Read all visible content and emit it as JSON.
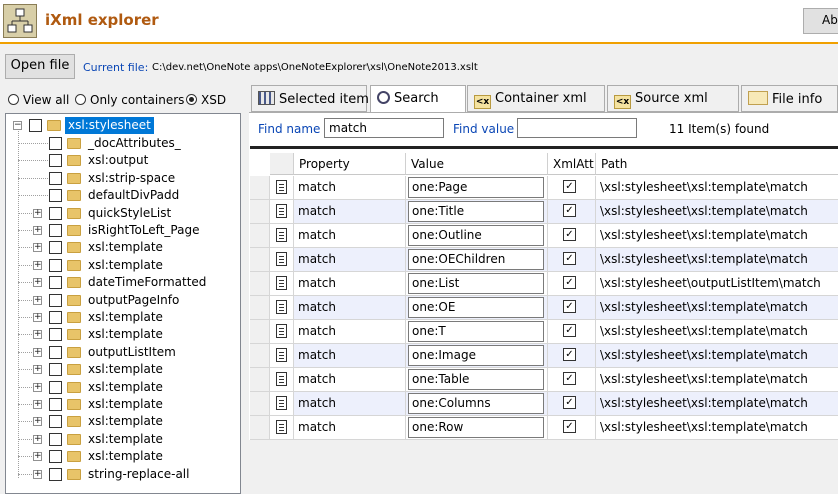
{
  "app": {
    "title": "iXml explorer",
    "about_label": "Ab"
  },
  "toolbar": {
    "open_file_label": "Open file",
    "current_file_label": "Current file:",
    "current_file_path": "C:\\dev.net\\OneNote apps\\OneNoteExplorer\\xsl\\OneNote2013.xslt"
  },
  "view_options": [
    {
      "label": "View all",
      "selected": false
    },
    {
      "label": "Only containers",
      "selected": false
    },
    {
      "label": "XSD",
      "selected": true
    }
  ],
  "tree": {
    "root": "xsl:stylesheet",
    "nodes": [
      {
        "label": "_docAttributes_",
        "expandable": false
      },
      {
        "label": "xsl:output",
        "expandable": false
      },
      {
        "label": "xsl:strip-space",
        "expandable": false
      },
      {
        "label": "defaultDivPadd",
        "expandable": false
      },
      {
        "label": "quickStyleList",
        "expandable": true
      },
      {
        "label": "isRightToLeft_Page",
        "expandable": true
      },
      {
        "label": "xsl:template",
        "expandable": true
      },
      {
        "label": "xsl:template",
        "expandable": true
      },
      {
        "label": "dateTimeFormatted",
        "expandable": true
      },
      {
        "label": "outputPageInfo",
        "expandable": true
      },
      {
        "label": "xsl:template",
        "expandable": true
      },
      {
        "label": "xsl:template",
        "expandable": true
      },
      {
        "label": "outputListItem",
        "expandable": true
      },
      {
        "label": "xsl:template",
        "expandable": true
      },
      {
        "label": "xsl:template",
        "expandable": true
      },
      {
        "label": "xsl:template",
        "expandable": true
      },
      {
        "label": "xsl:template",
        "expandable": true
      },
      {
        "label": "xsl:template",
        "expandable": true
      },
      {
        "label": "xsl:template",
        "expandable": true
      },
      {
        "label": "string-replace-all",
        "expandable": true
      }
    ]
  },
  "tabs": [
    {
      "label": "Selected item",
      "icon": "grid-icon",
      "active": false
    },
    {
      "label": "Search",
      "icon": "search-icon",
      "active": true
    },
    {
      "label": "Container xml",
      "icon": "xml-icon",
      "active": false
    },
    {
      "label": "Source xml",
      "icon": "xml-icon",
      "active": false
    },
    {
      "label": "File info",
      "icon": "file-info-icon",
      "active": false
    }
  ],
  "search": {
    "find_name_label": "Find name",
    "find_name_value": "match",
    "find_value_label": "Find value",
    "find_value_value": "",
    "items_found": "11  Item(s) found"
  },
  "grid": {
    "headers": [
      "Property",
      "Value",
      "XmlAtt",
      "Path"
    ],
    "rows": [
      {
        "property": "match",
        "value": "one:Page",
        "xmlatt": true,
        "path": "\\xsl:stylesheet\\xsl:template\\match"
      },
      {
        "property": "match",
        "value": "one:Title",
        "xmlatt": true,
        "path": "\\xsl:stylesheet\\xsl:template\\match"
      },
      {
        "property": "match",
        "value": "one:Outline",
        "xmlatt": true,
        "path": "\\xsl:stylesheet\\xsl:template\\match"
      },
      {
        "property": "match",
        "value": "one:OEChildren",
        "xmlatt": true,
        "path": "\\xsl:stylesheet\\xsl:template\\match"
      },
      {
        "property": "match",
        "value": "one:List",
        "xmlatt": true,
        "path": "\\xsl:stylesheet\\outputListItem\\match"
      },
      {
        "property": "match",
        "value": "one:OE",
        "xmlatt": true,
        "path": "\\xsl:stylesheet\\xsl:template\\match"
      },
      {
        "property": "match",
        "value": "one:T",
        "xmlatt": true,
        "path": "\\xsl:stylesheet\\xsl:template\\match"
      },
      {
        "property": "match",
        "value": "one:Image",
        "xmlatt": true,
        "path": "\\xsl:stylesheet\\xsl:template\\match"
      },
      {
        "property": "match",
        "value": "one:Table",
        "xmlatt": true,
        "path": "\\xsl:stylesheet\\xsl:template\\match"
      },
      {
        "property": "match",
        "value": "one:Columns",
        "xmlatt": true,
        "path": "\\xsl:stylesheet\\xsl:template\\match"
      },
      {
        "property": "match",
        "value": "one:Row",
        "xmlatt": true,
        "path": "\\xsl:stylesheet\\xsl:template\\match"
      }
    ]
  },
  "colors": {
    "accent": "#f0a000",
    "title": "#b05a10",
    "link_blue": "#0a46b5",
    "selection": "#0078d7",
    "alt_row": "#edf0fc"
  }
}
